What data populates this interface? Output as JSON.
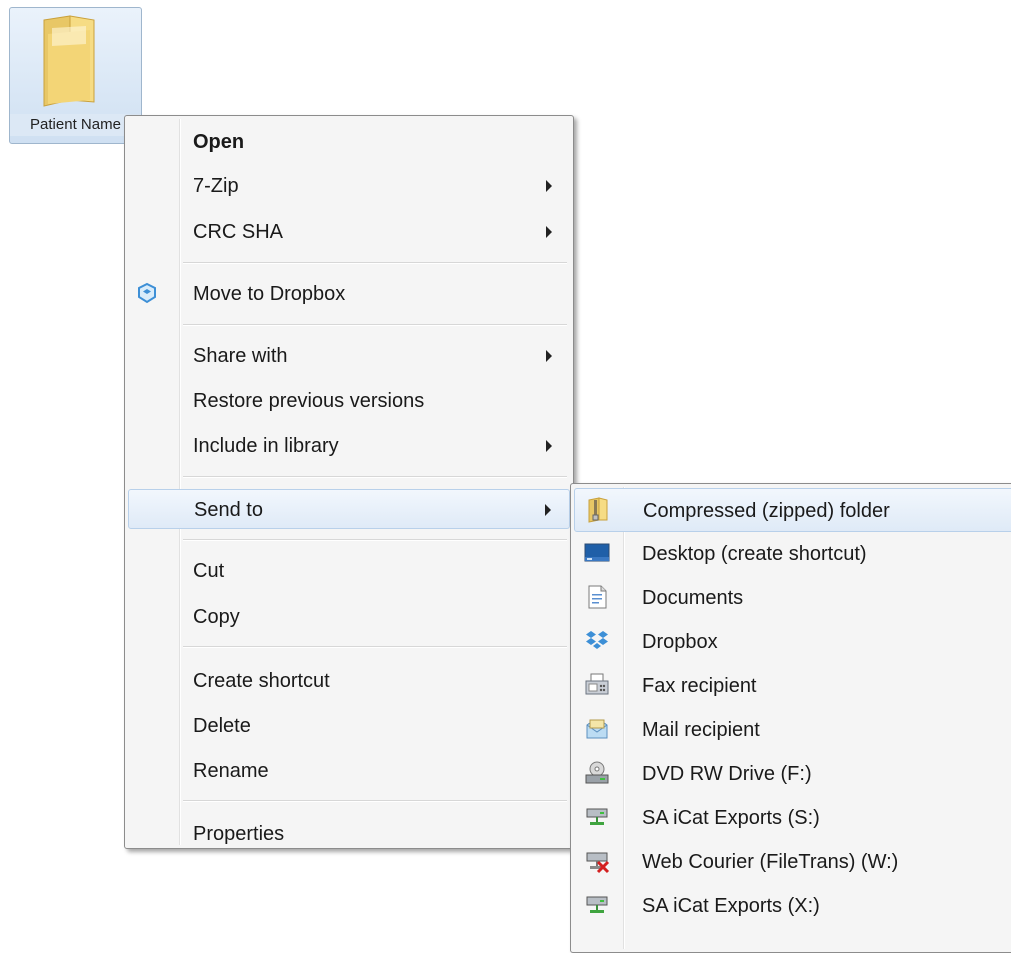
{
  "folder": {
    "name": "Patient Name",
    "icon": "folder-icon"
  },
  "menu": {
    "items": [
      {
        "label": "Open",
        "bold": true
      },
      {
        "label": "7-Zip",
        "submenu": true
      },
      {
        "label": "CRC SHA",
        "submenu": true
      },
      {
        "label": "Move to Dropbox",
        "icon": "dropbox-icon"
      },
      {
        "label": "Share with",
        "submenu": true
      },
      {
        "label": "Restore previous versions"
      },
      {
        "label": "Include in library",
        "submenu": true
      },
      {
        "label": "Send to",
        "submenu": true,
        "active": true
      },
      {
        "label": "Cut"
      },
      {
        "label": "Copy"
      },
      {
        "label": "Create shortcut"
      },
      {
        "label": "Delete"
      },
      {
        "label": "Rename"
      },
      {
        "label": "Properties"
      }
    ]
  },
  "sendto": {
    "items": [
      {
        "label": "Compressed (zipped) folder",
        "icon": "zip-folder-icon"
      },
      {
        "label": "Desktop (create shortcut)",
        "icon": "desktop-icon"
      },
      {
        "label": "Documents",
        "icon": "documents-icon"
      },
      {
        "label": "Dropbox",
        "icon": "dropbox-icon"
      },
      {
        "label": "Fax recipient",
        "icon": "fax-icon"
      },
      {
        "label": "Mail recipient",
        "icon": "mail-icon"
      },
      {
        "label": "DVD RW Drive (F:)",
        "icon": "dvd-drive-icon"
      },
      {
        "label": "SA iCat Exports (S:)",
        "icon": "network-drive-icon"
      },
      {
        "label": "Web Courier (FileTrans) (W:)",
        "icon": "disconnected-drive-icon"
      },
      {
        "label": "SA iCat Exports (X:)",
        "icon": "network-drive-icon"
      }
    ]
  },
  "colors": {
    "highlight": "#dfeaf7",
    "menu_bg": "#f5f5f5",
    "dropbox_blue": "#3d8fd6"
  }
}
